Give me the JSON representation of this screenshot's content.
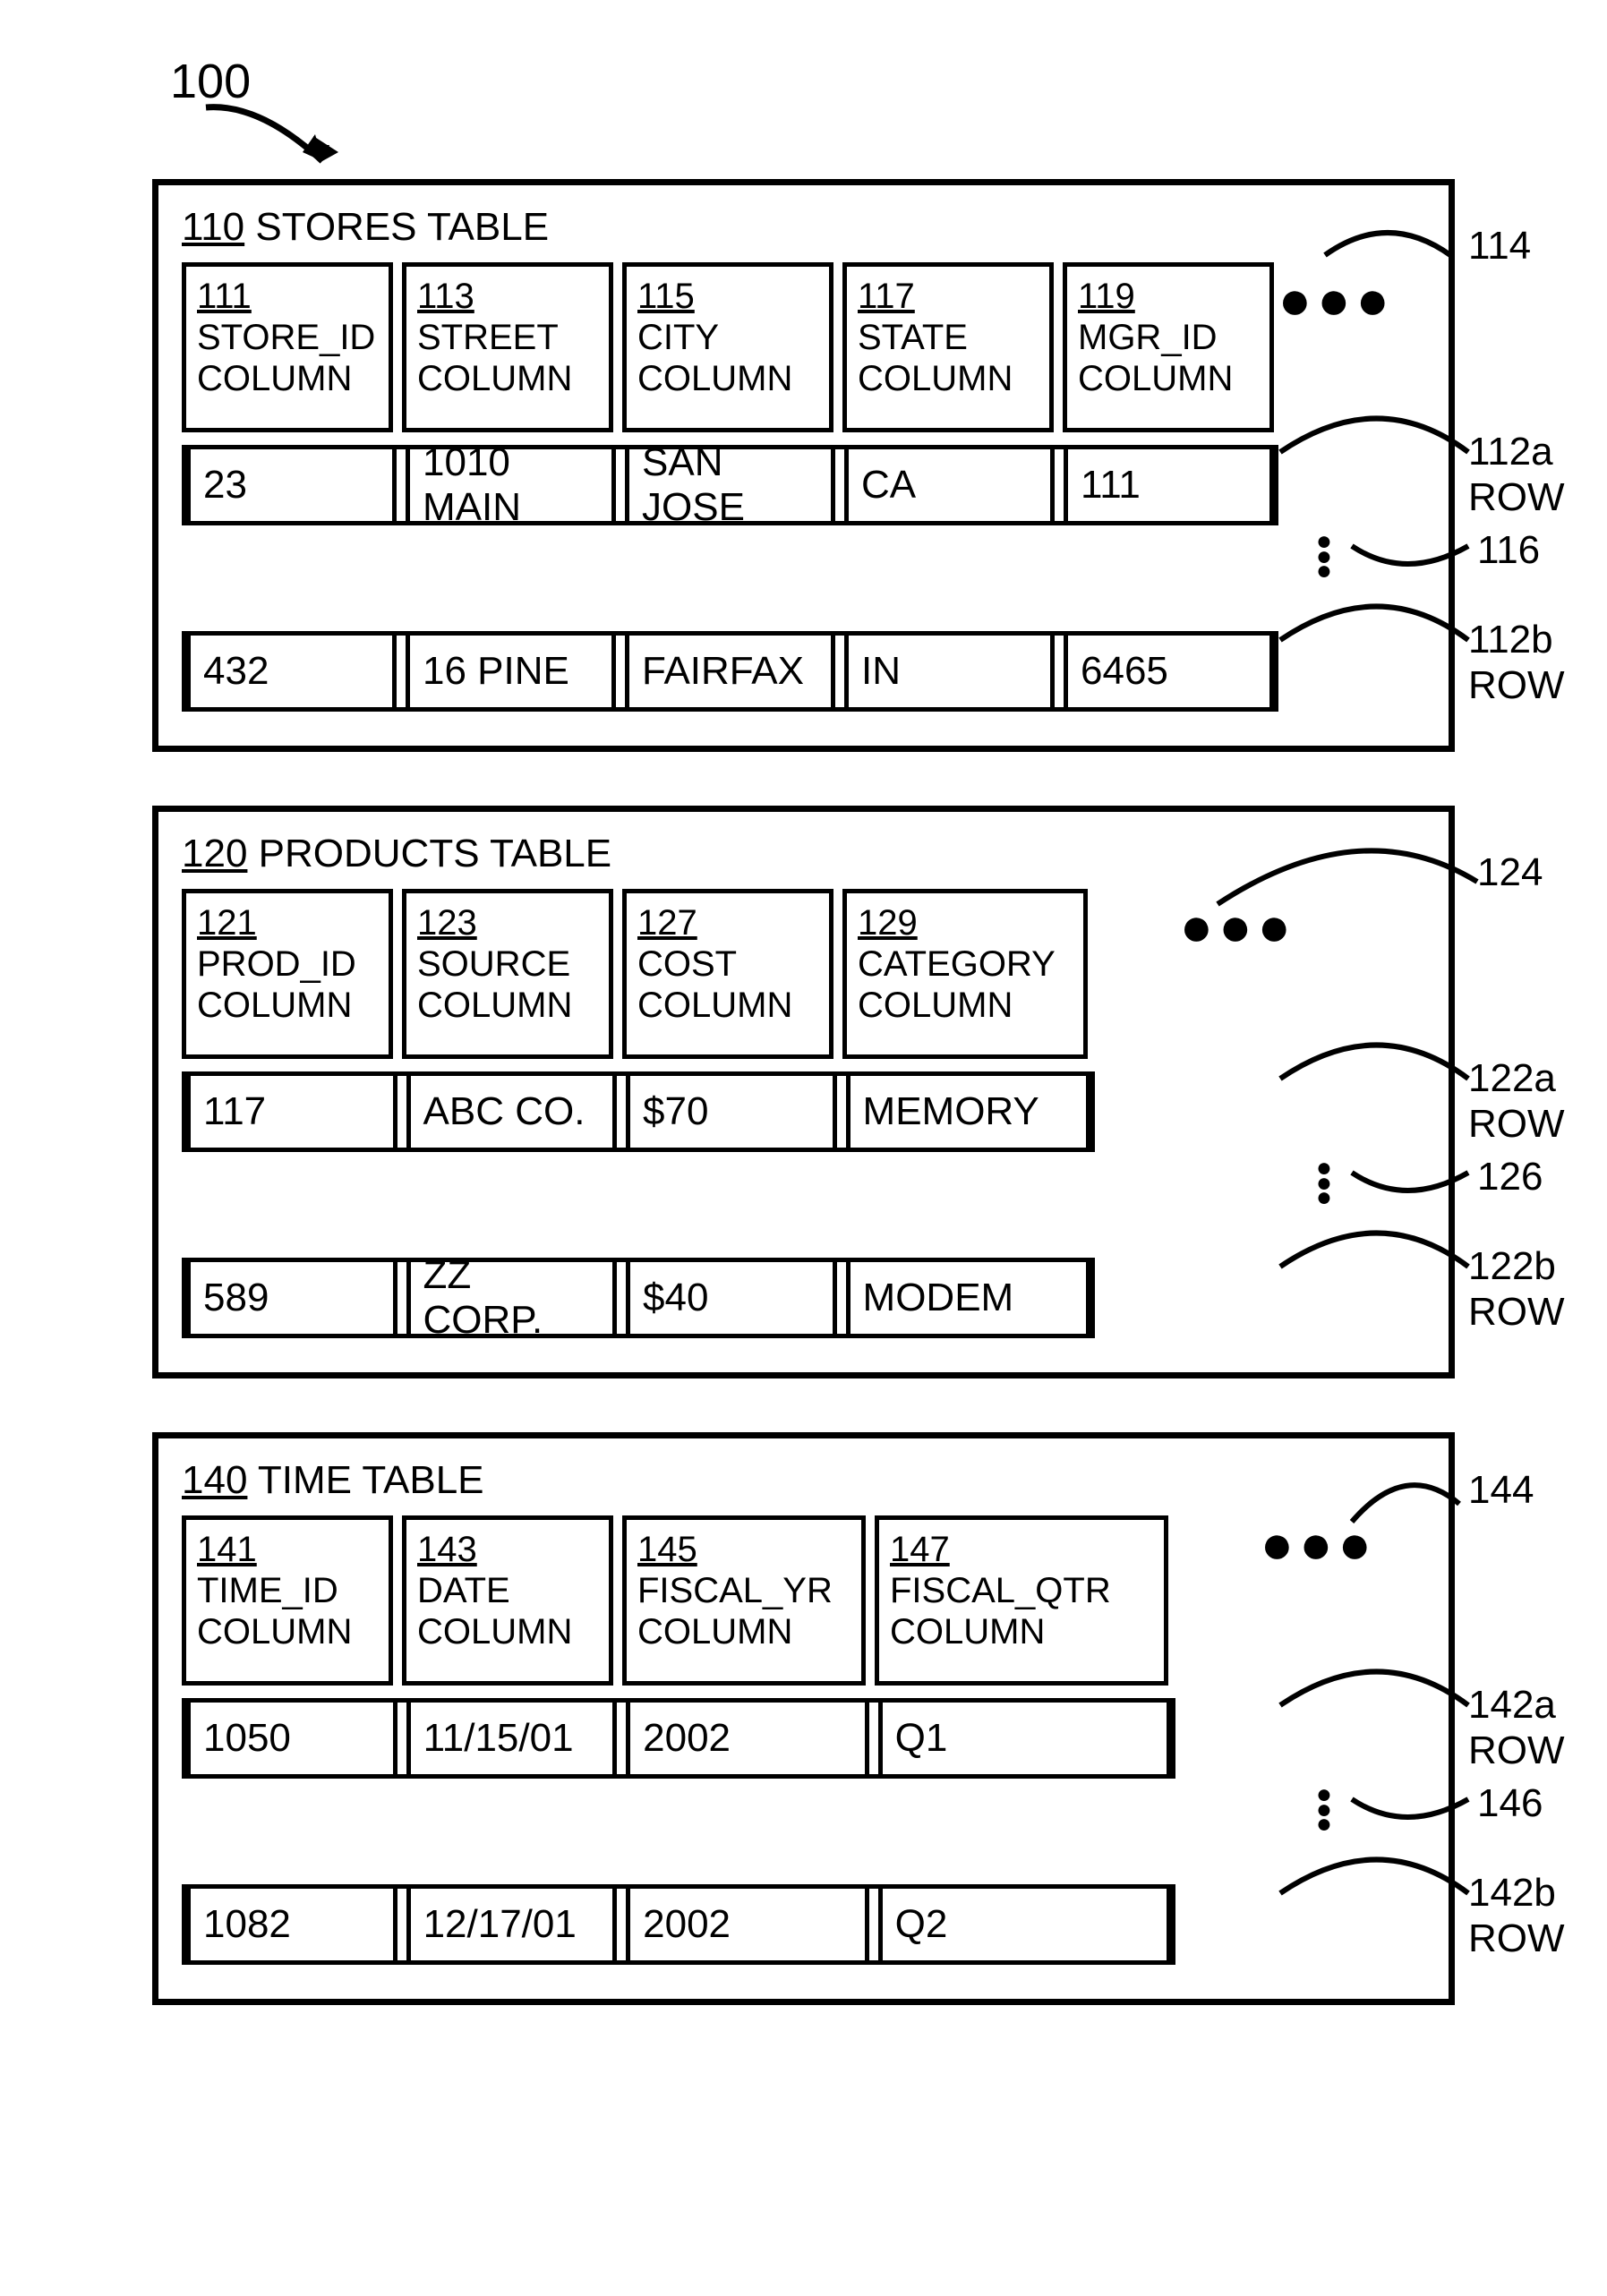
{
  "figure": {
    "ref": "100"
  },
  "tables": {
    "stores": {
      "ref": "110",
      "title": "STORES TABLE",
      "ellipsis_cols_ref": "114",
      "ellipsis_rows_ref": "116",
      "columns": [
        {
          "ref": "111",
          "name": "STORE_ID",
          "suffix": "COLUMN"
        },
        {
          "ref": "113",
          "name": "STREET",
          "suffix": "COLUMN"
        },
        {
          "ref": "115",
          "name": "CITY",
          "suffix": "COLUMN"
        },
        {
          "ref": "117",
          "name": "STATE",
          "suffix": "COLUMN"
        },
        {
          "ref": "119",
          "name": "MGR_ID",
          "suffix": "COLUMN"
        }
      ],
      "rows": [
        {
          "ref": "112a",
          "label": "ROW",
          "cells": [
            "23",
            "1010 MAIN",
            "SAN JOSE",
            "CA",
            "111"
          ]
        },
        {
          "ref": "112b",
          "label": "ROW",
          "cells": [
            "432",
            "16 PINE",
            "FAIRFAX",
            "IN",
            "6465"
          ]
        }
      ]
    },
    "products": {
      "ref": "120",
      "title": "PRODUCTS TABLE",
      "ellipsis_cols_ref": "124",
      "ellipsis_rows_ref": "126",
      "columns": [
        {
          "ref": "121",
          "name": "PROD_ID",
          "suffix": "COLUMN"
        },
        {
          "ref": "123",
          "name": "SOURCE",
          "suffix": "COLUMN"
        },
        {
          "ref": "127",
          "name": "COST",
          "suffix": "COLUMN"
        },
        {
          "ref": "129",
          "name": "CATEGORY",
          "suffix": "COLUMN"
        }
      ],
      "rows": [
        {
          "ref": "122a",
          "label": "ROW",
          "cells": [
            "117",
            "ABC CO.",
            "$70",
            "MEMORY"
          ]
        },
        {
          "ref": "122b",
          "label": "ROW",
          "cells": [
            "589",
            "ZZ CORP.",
            "$40",
            "MODEM"
          ]
        }
      ]
    },
    "time": {
      "ref": "140",
      "title": "TIME TABLE",
      "ellipsis_cols_ref": "144",
      "ellipsis_rows_ref": "146",
      "columns": [
        {
          "ref": "141",
          "name": "TIME_ID",
          "suffix": "COLUMN"
        },
        {
          "ref": "143",
          "name": "DATE",
          "suffix": "COLUMN"
        },
        {
          "ref": "145",
          "name": "FISCAL_YR",
          "suffix": "COLUMN"
        },
        {
          "ref": "147",
          "name": "FISCAL_QTR",
          "suffix": "COLUMN"
        }
      ],
      "rows": [
        {
          "ref": "142a",
          "label": "ROW",
          "cells": [
            "1050",
            "11/15/01",
            "2002",
            "Q1"
          ]
        },
        {
          "ref": "142b",
          "label": "ROW",
          "cells": [
            "1082",
            "12/17/01",
            "2002",
            "Q2"
          ]
        }
      ]
    }
  }
}
